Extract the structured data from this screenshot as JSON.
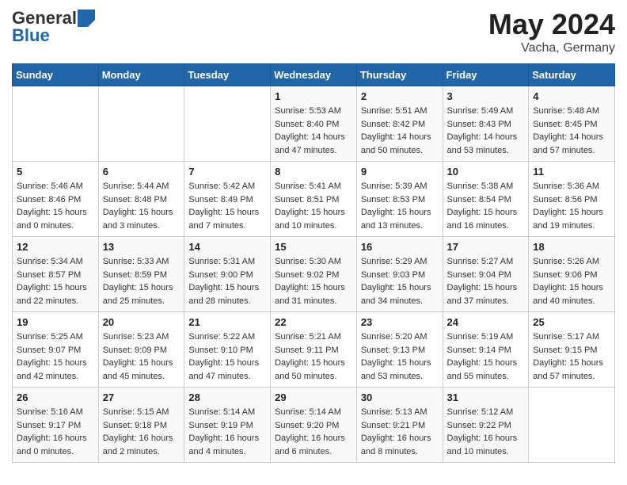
{
  "header": {
    "logo_general": "General",
    "logo_blue": "Blue",
    "title": "May 2024",
    "location": "Vacha, Germany"
  },
  "days_of_week": [
    "Sunday",
    "Monday",
    "Tuesday",
    "Wednesday",
    "Thursday",
    "Friday",
    "Saturday"
  ],
  "weeks": [
    [
      {
        "day": "",
        "info": ""
      },
      {
        "day": "",
        "info": ""
      },
      {
        "day": "",
        "info": ""
      },
      {
        "day": "1",
        "info": "Sunrise: 5:53 AM\nSunset: 8:40 PM\nDaylight: 14 hours\nand 47 minutes."
      },
      {
        "day": "2",
        "info": "Sunrise: 5:51 AM\nSunset: 8:42 PM\nDaylight: 14 hours\nand 50 minutes."
      },
      {
        "day": "3",
        "info": "Sunrise: 5:49 AM\nSunset: 8:43 PM\nDaylight: 14 hours\nand 53 minutes."
      },
      {
        "day": "4",
        "info": "Sunrise: 5:48 AM\nSunset: 8:45 PM\nDaylight: 14 hours\nand 57 minutes."
      }
    ],
    [
      {
        "day": "5",
        "info": "Sunrise: 5:46 AM\nSunset: 8:46 PM\nDaylight: 15 hours\nand 0 minutes."
      },
      {
        "day": "6",
        "info": "Sunrise: 5:44 AM\nSunset: 8:48 PM\nDaylight: 15 hours\nand 3 minutes."
      },
      {
        "day": "7",
        "info": "Sunrise: 5:42 AM\nSunset: 8:49 PM\nDaylight: 15 hours\nand 7 minutes."
      },
      {
        "day": "8",
        "info": "Sunrise: 5:41 AM\nSunset: 8:51 PM\nDaylight: 15 hours\nand 10 minutes."
      },
      {
        "day": "9",
        "info": "Sunrise: 5:39 AM\nSunset: 8:53 PM\nDaylight: 15 hours\nand 13 minutes."
      },
      {
        "day": "10",
        "info": "Sunrise: 5:38 AM\nSunset: 8:54 PM\nDaylight: 15 hours\nand 16 minutes."
      },
      {
        "day": "11",
        "info": "Sunrise: 5:36 AM\nSunset: 8:56 PM\nDaylight: 15 hours\nand 19 minutes."
      }
    ],
    [
      {
        "day": "12",
        "info": "Sunrise: 5:34 AM\nSunset: 8:57 PM\nDaylight: 15 hours\nand 22 minutes."
      },
      {
        "day": "13",
        "info": "Sunrise: 5:33 AM\nSunset: 8:59 PM\nDaylight: 15 hours\nand 25 minutes."
      },
      {
        "day": "14",
        "info": "Sunrise: 5:31 AM\nSunset: 9:00 PM\nDaylight: 15 hours\nand 28 minutes."
      },
      {
        "day": "15",
        "info": "Sunrise: 5:30 AM\nSunset: 9:02 PM\nDaylight: 15 hours\nand 31 minutes."
      },
      {
        "day": "16",
        "info": "Sunrise: 5:29 AM\nSunset: 9:03 PM\nDaylight: 15 hours\nand 34 minutes."
      },
      {
        "day": "17",
        "info": "Sunrise: 5:27 AM\nSunset: 9:04 PM\nDaylight: 15 hours\nand 37 minutes."
      },
      {
        "day": "18",
        "info": "Sunrise: 5:26 AM\nSunset: 9:06 PM\nDaylight: 15 hours\nand 40 minutes."
      }
    ],
    [
      {
        "day": "19",
        "info": "Sunrise: 5:25 AM\nSunset: 9:07 PM\nDaylight: 15 hours\nand 42 minutes."
      },
      {
        "day": "20",
        "info": "Sunrise: 5:23 AM\nSunset: 9:09 PM\nDaylight: 15 hours\nand 45 minutes."
      },
      {
        "day": "21",
        "info": "Sunrise: 5:22 AM\nSunset: 9:10 PM\nDaylight: 15 hours\nand 47 minutes."
      },
      {
        "day": "22",
        "info": "Sunrise: 5:21 AM\nSunset: 9:11 PM\nDaylight: 15 hours\nand 50 minutes."
      },
      {
        "day": "23",
        "info": "Sunrise: 5:20 AM\nSunset: 9:13 PM\nDaylight: 15 hours\nand 53 minutes."
      },
      {
        "day": "24",
        "info": "Sunrise: 5:19 AM\nSunset: 9:14 PM\nDaylight: 15 hours\nand 55 minutes."
      },
      {
        "day": "25",
        "info": "Sunrise: 5:17 AM\nSunset: 9:15 PM\nDaylight: 15 hours\nand 57 minutes."
      }
    ],
    [
      {
        "day": "26",
        "info": "Sunrise: 5:16 AM\nSunset: 9:17 PM\nDaylight: 16 hours\nand 0 minutes."
      },
      {
        "day": "27",
        "info": "Sunrise: 5:15 AM\nSunset: 9:18 PM\nDaylight: 16 hours\nand 2 minutes."
      },
      {
        "day": "28",
        "info": "Sunrise: 5:14 AM\nSunset: 9:19 PM\nDaylight: 16 hours\nand 4 minutes."
      },
      {
        "day": "29",
        "info": "Sunrise: 5:14 AM\nSunset: 9:20 PM\nDaylight: 16 hours\nand 6 minutes."
      },
      {
        "day": "30",
        "info": "Sunrise: 5:13 AM\nSunset: 9:21 PM\nDaylight: 16 hours\nand 8 minutes."
      },
      {
        "day": "31",
        "info": "Sunrise: 5:12 AM\nSunset: 9:22 PM\nDaylight: 16 hours\nand 10 minutes."
      },
      {
        "day": "",
        "info": ""
      }
    ]
  ]
}
